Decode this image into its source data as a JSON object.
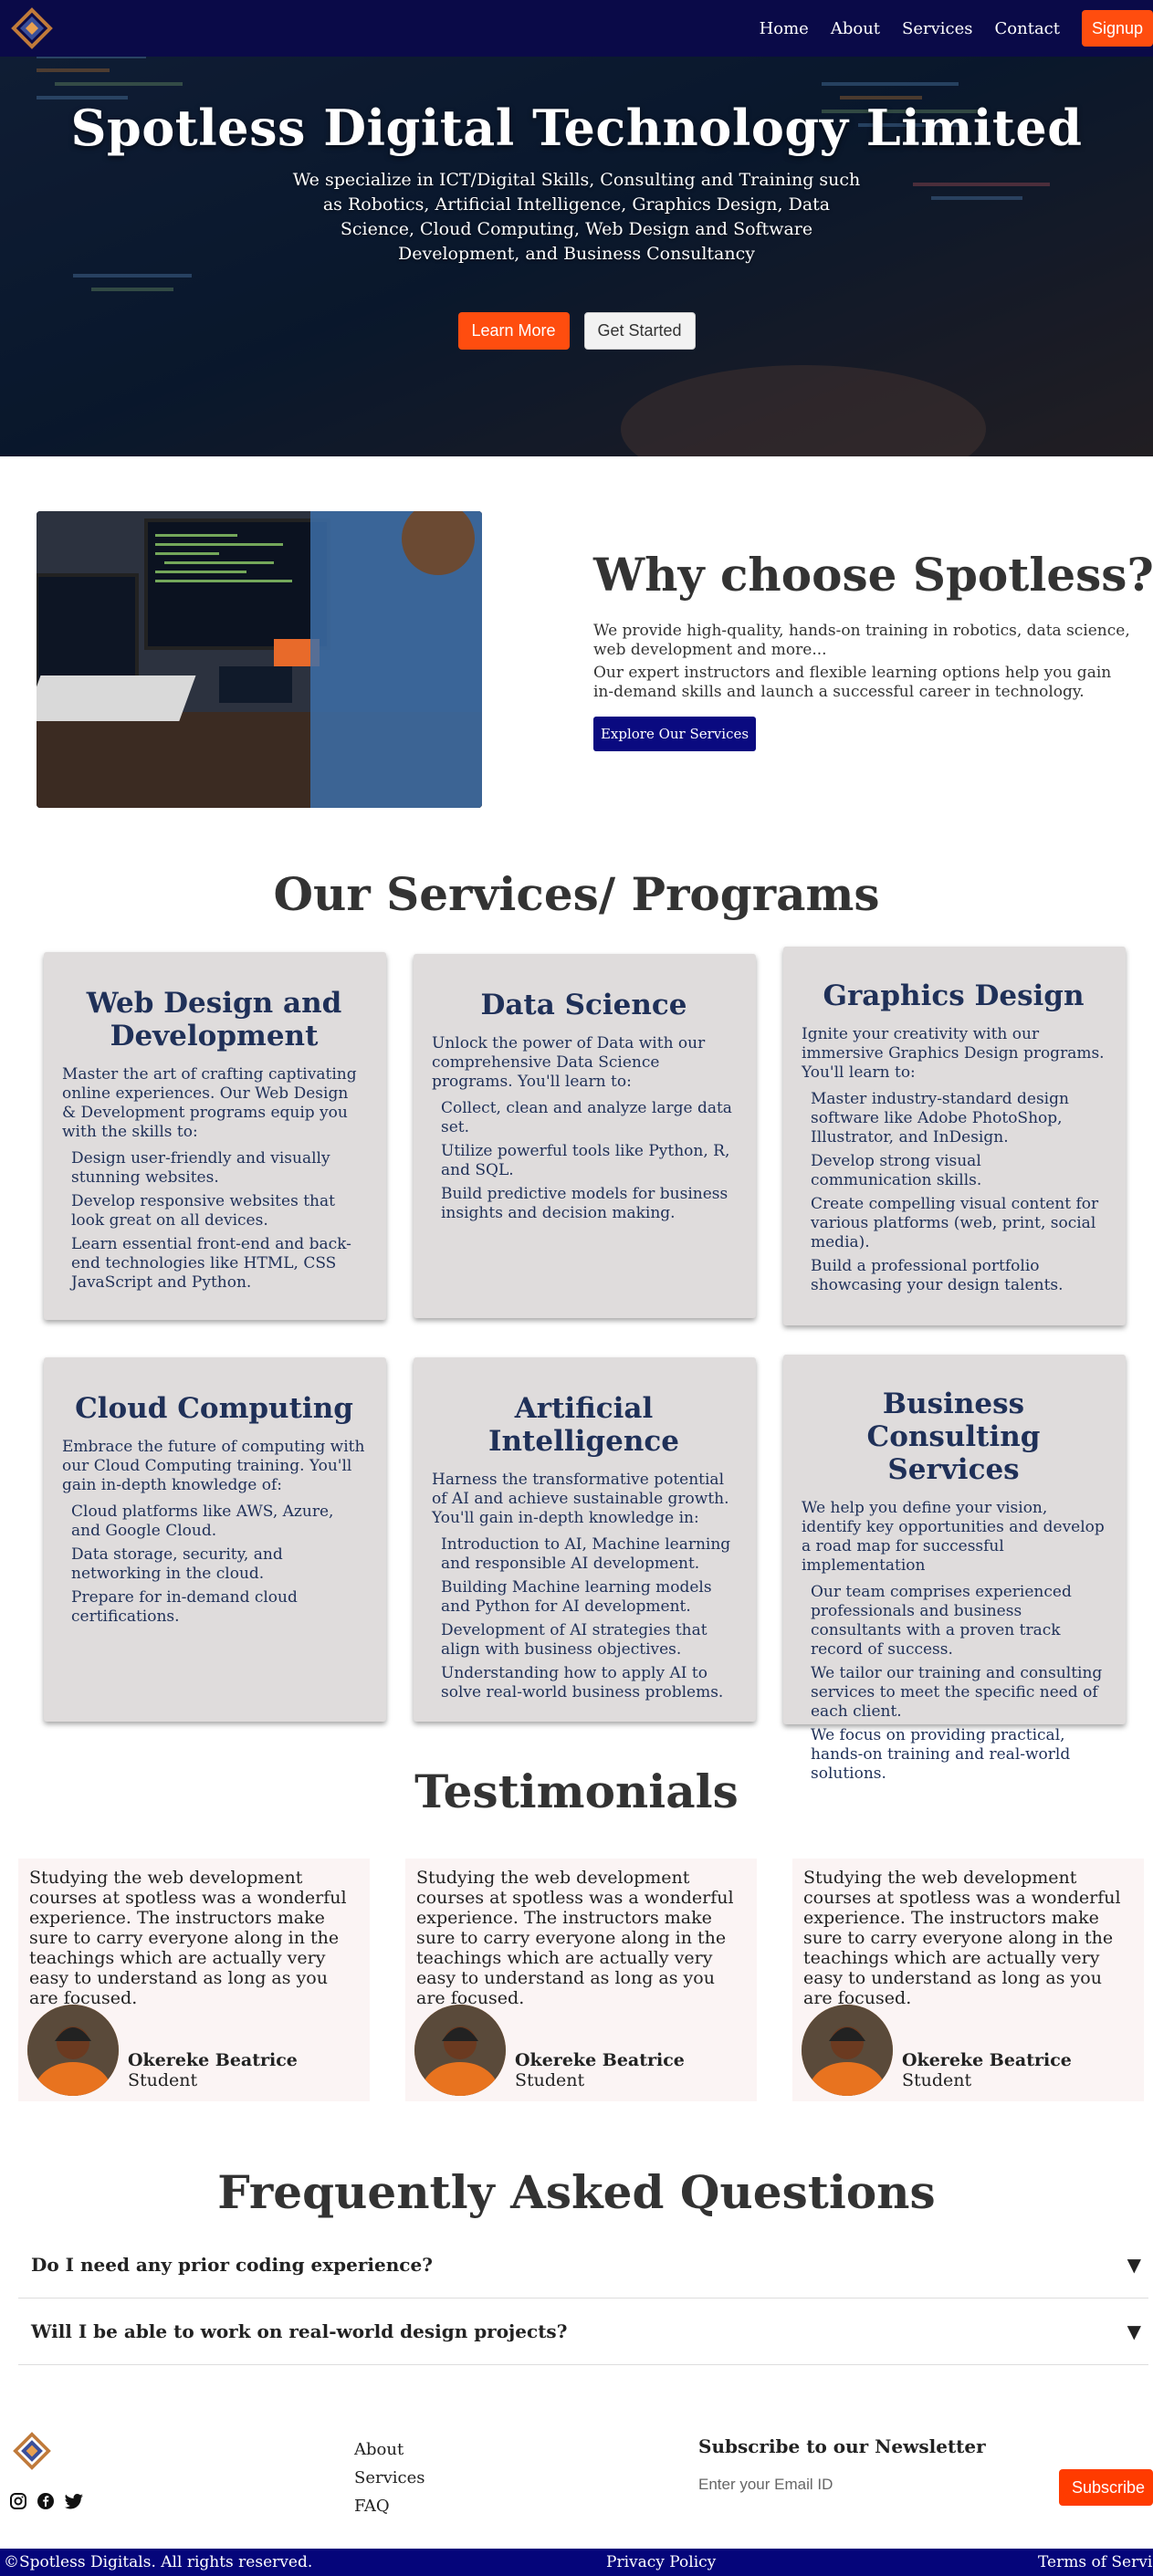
{
  "nav": {
    "links": [
      "Home",
      "About",
      "Services",
      "Contact"
    ],
    "signup": "Signup"
  },
  "hero": {
    "title": "Spotless Digital Technology Limited",
    "subtitle": "We specialize in ICT/Digital Skills, Consulting and Training such as Robotics, Artificial Intelligence, Graphics Design, Data Science, Cloud Computing, Web Design and Software Development, and Business Consultancy",
    "learn_more": "Learn More",
    "get_started": "Get Started"
  },
  "why": {
    "title": "Why choose Spotless?",
    "p1": "We provide high-quality, hands-on training in robotics, data science, web development and more...",
    "p2": "Our expert instructors and flexible learning options help you gain in-demand skills and launch a successful career in technology.",
    "button": "Explore Our Services"
  },
  "services": {
    "title": "Our Services/ Programs",
    "cards": [
      {
        "title": "Web Design and Development",
        "intro": "Master the art of crafting captivating online experiences. Our Web Design & Development programs equip you with the skills to:",
        "items": [
          "Design user-friendly and visually stunning websites.",
          "Develop responsive websites that look great on all devices.",
          "Learn essential front-end and back-end technologies like HTML, CSS JavaScript and Python."
        ]
      },
      {
        "title": "Data Science",
        "intro": "Unlock the power of Data with our comprehensive Data Science programs. You'll learn to:",
        "items": [
          "Collect, clean and analyze large data set.",
          "Utilize powerful tools like Python, R, and SQL.",
          "Build predictive models for business insights and decision making."
        ]
      },
      {
        "title": "Graphics Design",
        "intro": "Ignite your creativity with our immersive Graphics Design programs. You'll learn to:",
        "items": [
          "Master industry-standard design software like Adobe PhotoShop, Illustrator, and InDesign.",
          "Develop strong visual communication skills.",
          "Create compelling visual content for various platforms (web, print, social media).",
          "Build a professional portfolio showcasing your design talents."
        ]
      },
      {
        "title": "Cloud Computing",
        "intro": "Embrace the future of computing with our Cloud Computing training. You'll gain in-depth knowledge of:",
        "items": [
          "Cloud platforms like AWS, Azure, and Google Cloud.",
          "Data storage, security, and networking in the cloud.",
          "Prepare for in-demand cloud certifications."
        ]
      },
      {
        "title": "Artificial Intelligence",
        "intro": "Harness the transformative potential of AI and achieve sustainable growth. You'll gain in-depth knowledge in:",
        "items": [
          "Introduction to AI, Machine learning and responsible AI development.",
          "Building Machine learning models and Python for AI development.",
          "Development of AI strategies that align with business objectives.",
          "Understanding how to apply AI to solve real-world business problems."
        ]
      },
      {
        "title": "Business Consulting Services",
        "intro": "We help you define your vision, identify key opportunities and develop a road map for successful implementation",
        "items": [
          "Our team comprises experienced professionals and business consultants with a proven track record of success.",
          "We tailor our training and consulting services to meet the specific need of each client.",
          "We focus on providing practical, hands-on training and real-world solutions."
        ]
      }
    ]
  },
  "testimonials": {
    "title": "Testimonials",
    "items": [
      {
        "text": "Studying the web development courses at spotless was a wonderful experience. The instructors make sure to carry everyone along in the teachings which are actually very easy to understand as long as you are focused.",
        "name": "Okereke Beatrice",
        "role": "Student"
      },
      {
        "text": "Studying the web development courses at spotless was a wonderful experience. The instructors make sure to carry everyone along in the teachings which are actually very easy to understand as long as you are focused.",
        "name": "Okereke Beatrice",
        "role": "Student"
      },
      {
        "text": "Studying the web development courses at spotless was a wonderful experience. The instructors make sure to carry everyone along in the teachings which are actually very easy to understand as long as you are focused.",
        "name": "Okereke Beatrice",
        "role": "Student"
      }
    ]
  },
  "faq": {
    "title": "Frequently Asked Questions",
    "items": [
      {
        "q": "Do I need any prior coding experience?",
        "arrow": "▼"
      },
      {
        "q": "Will I be able to work on real-world design projects?",
        "arrow": "▼"
      }
    ]
  },
  "footer": {
    "links": [
      "About",
      "Services",
      "FAQ"
    ],
    "newsletter_title": "Subscribe to our Newsletter",
    "email_placeholder": "Enter your Email ID",
    "subscribe": "Subscribe",
    "copyright": "©Spotless Digitals. All rights reserved.",
    "privacy": "Privacy Policy",
    "terms": "Terms of Service"
  },
  "colors": {
    "nav": "#0a0a48",
    "accent": "#ff4d0f",
    "primary_button": "#0a0a80",
    "card_bg": "#dfdcdc",
    "card_text": "#1f3058",
    "footer_bar": "#05057a"
  }
}
